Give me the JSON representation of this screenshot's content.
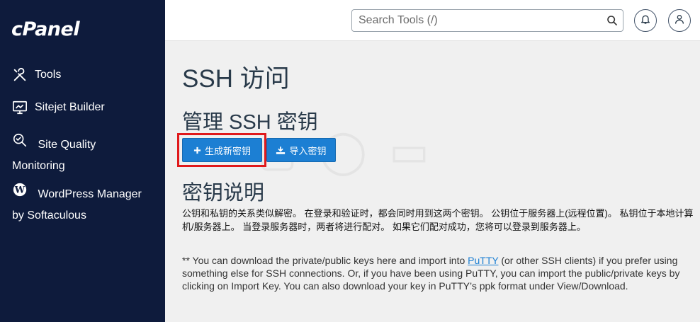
{
  "sidebar": {
    "logo": "cPanel",
    "items": [
      {
        "label": "Tools",
        "icon": "tools-icon"
      },
      {
        "label": "Sitejet Builder",
        "icon": "monitor-icon"
      },
      {
        "label_line1": "Site Quality",
        "label_line2": "Monitoring",
        "icon": "magnifier-check-icon"
      },
      {
        "label_line1": "WordPress Manager",
        "label_line2": "by Softaculous",
        "icon": "wordpress-icon"
      }
    ]
  },
  "header": {
    "search_placeholder": "Search Tools (/)"
  },
  "main": {
    "page_title": "SSH 访问",
    "manage_title": "管理 SSH 密钥",
    "generate_button": "生成新密钥",
    "import_button": "导入密钥",
    "desc_title": "密钥说明",
    "desc_text": "公钥和私钥的关系类似解密。 在登录和验证时，都会同时用到这两个密钥。 公钥位于服务器上(远程位置)。 私钥位于本地计算机/服务器上。 当登录服务器时，两者将进行配对。 如果它们配对成功，您将可以登录到服务器上。",
    "note_prefix": "** You can download the private/public keys here and import into ",
    "note_link": "PuTTY",
    "note_suffix": " (or other SSH clients) if you prefer using something else for SSH connections. Or, if you have been using PuTTY, you can import the public/private keys by clicking on Import Key. You can also download your key in PuTTY’s ppk format under View/Download."
  },
  "colors": {
    "sidebar_bg": "#0e1b3c",
    "button_blue": "#1c7fd3",
    "highlight_red": "#e0191b"
  }
}
